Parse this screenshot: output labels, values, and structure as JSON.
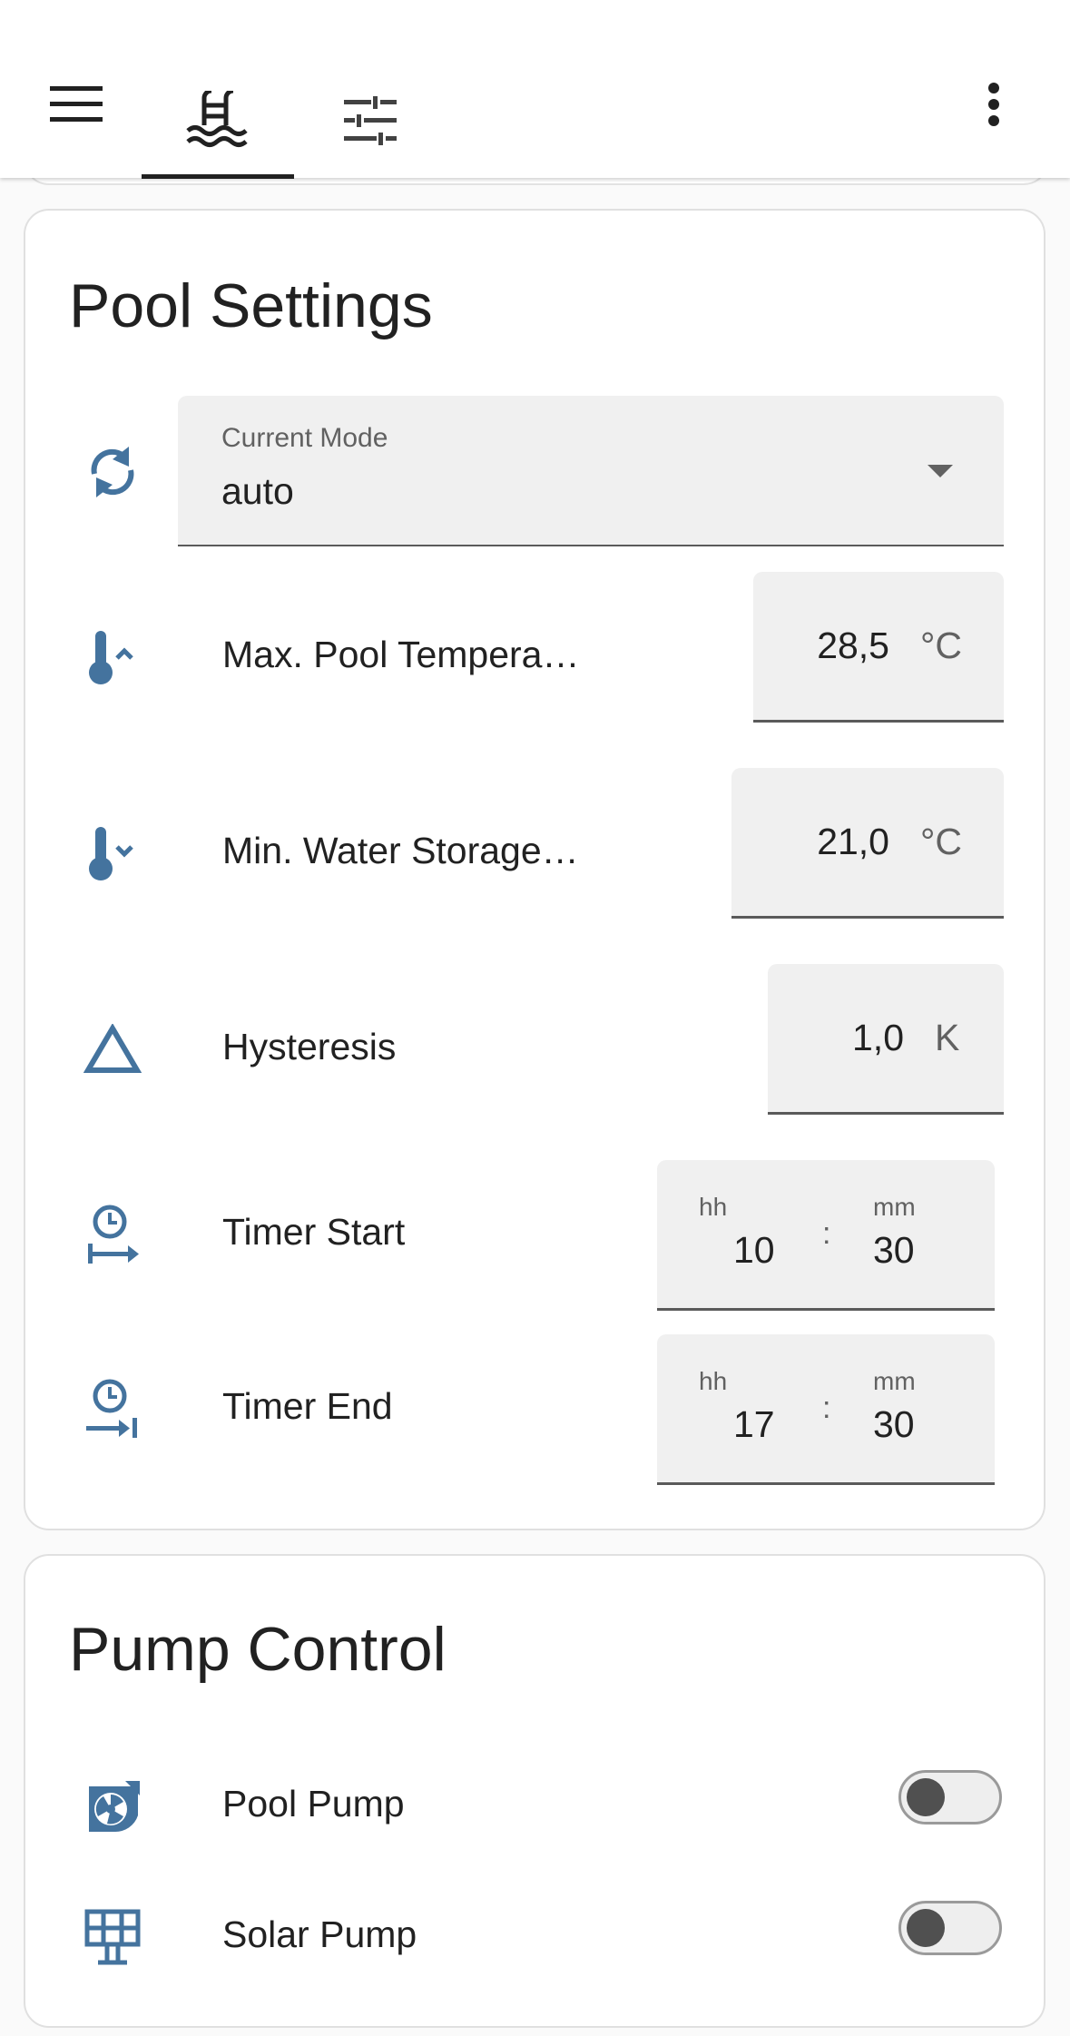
{
  "topbar": {
    "icons": {
      "menu": "menu-icon",
      "pool": "pool-icon",
      "settings": "tune-icon",
      "more": "dots-vertical-icon"
    }
  },
  "pool_settings": {
    "title": "Pool Settings",
    "mode": {
      "label": "Current Mode",
      "value": "auto",
      "icon": "sync-icon"
    },
    "max_pool_temp": {
      "label": "Max. Pool Tempera…",
      "value": "28,5",
      "unit": "°C",
      "icon": "thermometer-chevron-up-icon"
    },
    "min_storage_temp": {
      "label": "Min. Water Storage…",
      "value": "21,0",
      "unit": "°C",
      "icon": "thermometer-chevron-down-icon"
    },
    "hysteresis": {
      "label": "Hysteresis",
      "value": "1,0",
      "unit": "K",
      "icon": "triangle-outline-icon"
    },
    "timer_start": {
      "label": "Timer Start",
      "hh_label": "hh",
      "mm_label": "mm",
      "hh": "10",
      "mm": "30",
      "sep": ":",
      "icon": "clock-start-icon"
    },
    "timer_end": {
      "label": "Timer End",
      "hh_label": "hh",
      "mm_label": "mm",
      "hh": "17",
      "mm": "30",
      "sep": ":",
      "icon": "clock-end-icon"
    }
  },
  "pump_control": {
    "title": "Pump Control",
    "pool_pump": {
      "label": "Pool Pump",
      "on": false,
      "icon": "pump-icon"
    },
    "solar_pump": {
      "label": "Solar Pump",
      "on": false,
      "icon": "solar-panel-icon"
    }
  },
  "colors": {
    "icon_blue": "#44739e",
    "text": "#212121",
    "field_bg": "#f0f0f0"
  }
}
